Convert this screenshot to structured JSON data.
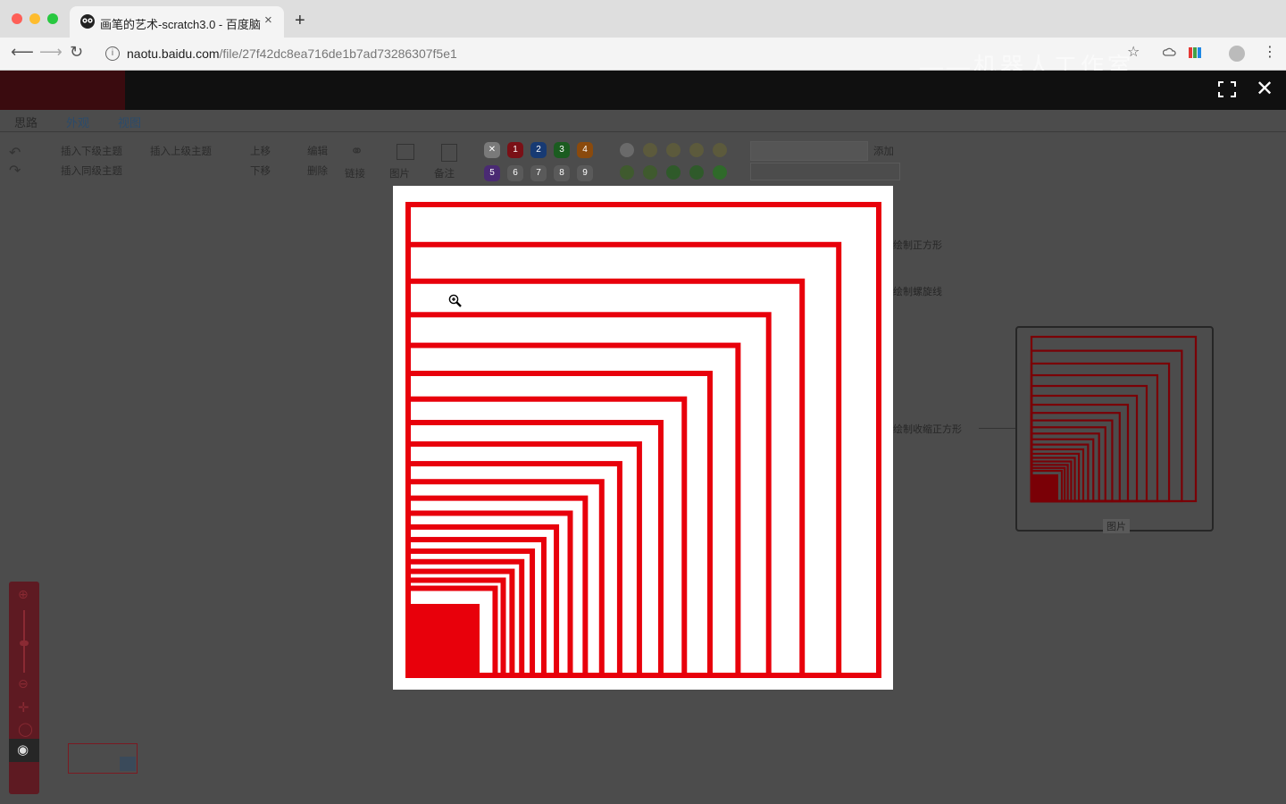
{
  "browser": {
    "tab_title": "画笔的艺术-scratch3.0 - 百度脑",
    "tab_close": "×",
    "new_tab": "+",
    "url_host": "naotu.baidu.com",
    "url_path": "/file/27f42dc8ea716de1b7ad73286307f5e1",
    "watermark": "——机器人工作室",
    "icons": [
      "back-icon",
      "forward-icon",
      "reload-icon",
      "info-icon",
      "star-icon",
      "menu-icon"
    ]
  },
  "app": {
    "close_glyph": "✕",
    "menu_tabs": [
      "思路",
      "外观",
      "视图"
    ],
    "ribbon": {
      "insert_child": "插入下级主题",
      "insert_parent": "插入上级主题",
      "insert_sibling": "插入同级主题",
      "move_up": "上移",
      "move_down": "下移",
      "edit": "编辑",
      "delete": "删除",
      "link": "链接",
      "image": "图片",
      "note": "备注",
      "add": "添加",
      "priorities": [
        "1",
        "2",
        "3",
        "4",
        "5",
        "6",
        "7",
        "8",
        "9"
      ]
    },
    "mindmap_nodes": [
      "绘制正方形",
      "绘制螺旋线",
      "绘制收缩正方形"
    ],
    "image_node_caption": "图片"
  },
  "colors": {
    "accent_red": "#e8000b",
    "modal_bg": "#ffffff",
    "overlay": "#4c4c4c"
  },
  "preview": {
    "shape": "nested-squares",
    "square_count": 20
  }
}
